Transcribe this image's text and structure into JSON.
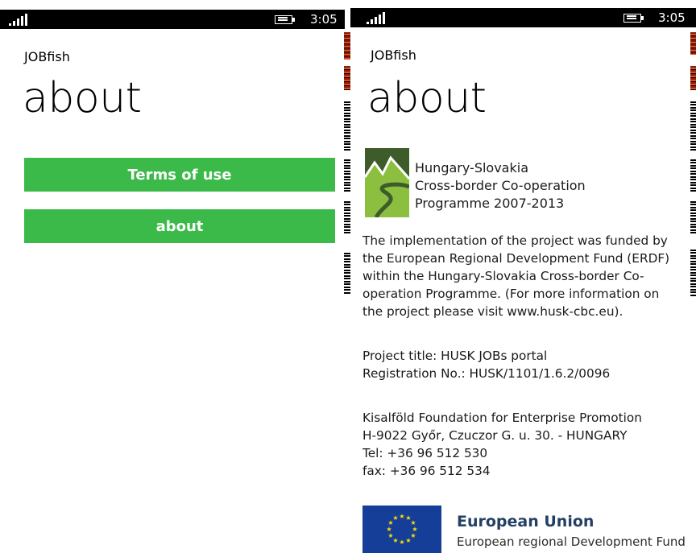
{
  "status_bar": {
    "time": "3:05"
  },
  "left_screen": {
    "app_name": "JOBfish",
    "page_title": "about",
    "buttons": [
      {
        "label": "Terms of use",
        "color": "#3bba4a"
      },
      {
        "label": "about",
        "color": "#3bba4a"
      }
    ]
  },
  "right_screen": {
    "app_name": "JOBfish",
    "page_title": "about",
    "programme_logo": {
      "lines": [
        "Hungary-Slovakia",
        "Cross-border Co-operation",
        "Programme 2007-2013"
      ],
      "colors": {
        "dark": "#3e5c2a",
        "light": "#8cbf3f"
      }
    },
    "funding_paragraph": [
      "The implementation of the project was funded by",
      "the European Regional Development Fund (ERDF)",
      "within the Hungary-Slovakia Cross-border Co-",
      "operation Programme. (For more information on",
      "the project please visit www.husk-cbc.eu)."
    ],
    "project_info": [
      "Project title: HUSK JOBs portal",
      "Registration No.: HUSK/1101/1.6.2/0096"
    ],
    "contact": [
      "Kisalföld Foundation for Enterprise Promotion",
      "H-9022 Győr, Czuczor G. u. 30. - HUNGARY",
      "Tel: +36 96 512 530",
      "fax: +36 96 512 534"
    ],
    "eu_logo": {
      "title": "European Union",
      "subtitle": "European regional Development Fund",
      "flag_color": "#143e98",
      "star_color": "#ffdd00"
    }
  }
}
